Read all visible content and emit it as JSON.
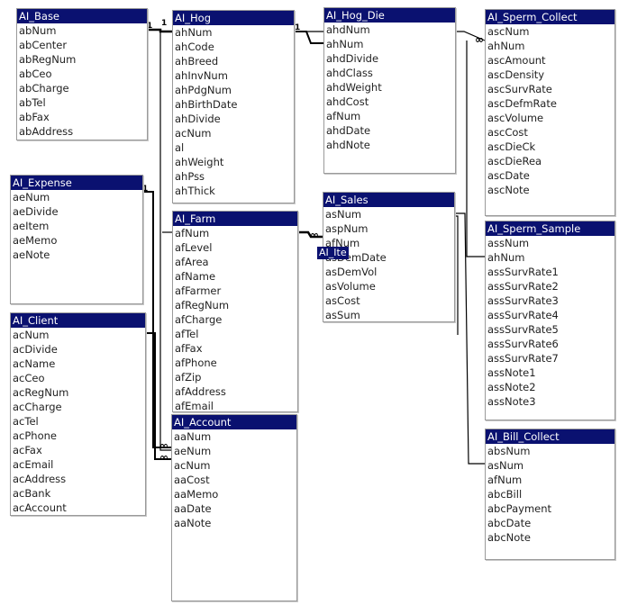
{
  "tables": [
    {
      "key": "base",
      "title": "AI_Base",
      "fields": [
        "abNum",
        "abCenter",
        "abRegNum",
        "abCeo",
        "abCharge",
        "abTel",
        "abFax",
        "abAddress"
      ]
    },
    {
      "key": "hog",
      "title": "AI_Hog",
      "fields": [
        "ahNum",
        "ahCode",
        "ahBreed",
        "ahInvNum",
        "ahPdgNum",
        "ahBirthDate",
        "ahDivide",
        "acNum",
        "al",
        "ahWeight",
        "ahPss",
        "ahThick"
      ]
    },
    {
      "key": "hogdie",
      "title": "AI_Hog_Die",
      "fields": [
        "ahdNum",
        "ahNum",
        "ahdDivide",
        "ahdClass",
        "ahdWeight",
        "ahdCost",
        "afNum",
        "ahdDate",
        "ahdNote"
      ]
    },
    {
      "key": "spermcollect",
      "title": "AI_Sperm_Collect",
      "fields": [
        "ascNum",
        "ahNum",
        "ascAmount",
        "ascDensity",
        "ascSurvRate",
        "ascDefmRate",
        "ascVolume",
        "ascCost",
        "ascDieCk",
        "ascDieRea",
        "ascDate",
        "ascNote"
      ]
    },
    {
      "key": "expense",
      "title": "AI_Expense",
      "fields": [
        "aeNum",
        "aeDivide",
        "aeItem",
        "aeMemo",
        "aeNote"
      ]
    },
    {
      "key": "farm",
      "title": "AI_Farm",
      "fields": [
        "afNum",
        "afLevel",
        "afArea",
        "afName",
        "afFarmer",
        "afRegNum",
        "afCharge",
        "afTel",
        "afFax",
        "afPhone",
        "afZip",
        "afAddress",
        "afEmail"
      ]
    },
    {
      "key": "sales",
      "title": "AI_Sales",
      "fields": [
        "asNum",
        "aspNum",
        "afNum",
        "asDemDate",
        "asDemVol",
        "asVolume",
        "asCost",
        "asSum"
      ]
    },
    {
      "key": "spermsample",
      "title": "AI_Sperm_Sample",
      "fields": [
        "assNum",
        "ahNum",
        "assSurvRate1",
        "assSurvRate2",
        "assSurvRate3",
        "assSurvRate4",
        "assSurvRate5",
        "assSurvRate6",
        "assSurvRate7",
        "assNote1",
        "assNote2",
        "assNote3"
      ]
    },
    {
      "key": "client",
      "title": "AI_Client",
      "fields": [
        "acNum",
        "acDivide",
        "acName",
        "acCeo",
        "acRegNum",
        "acCharge",
        "acTel",
        "acPhone",
        "acFax",
        "acEmail",
        "acAddress",
        "acBank",
        "acAccount"
      ]
    },
    {
      "key": "account",
      "title": "AI_Account",
      "fields": [
        "aaNum",
        "aeNum",
        "acNum",
        "aaCost",
        "aaMemo",
        "aaDate",
        "aaNote"
      ]
    },
    {
      "key": "billcollect",
      "title": "AI_Bill_Collect",
      "fields": [
        "absNum",
        "asNum",
        "afNum",
        "abcBill",
        "abcPayment",
        "abcDate",
        "abcNote"
      ]
    }
  ],
  "overlay_title": "AI_Ite",
  "cardinality": {
    "one": "1",
    "many": "∞"
  }
}
